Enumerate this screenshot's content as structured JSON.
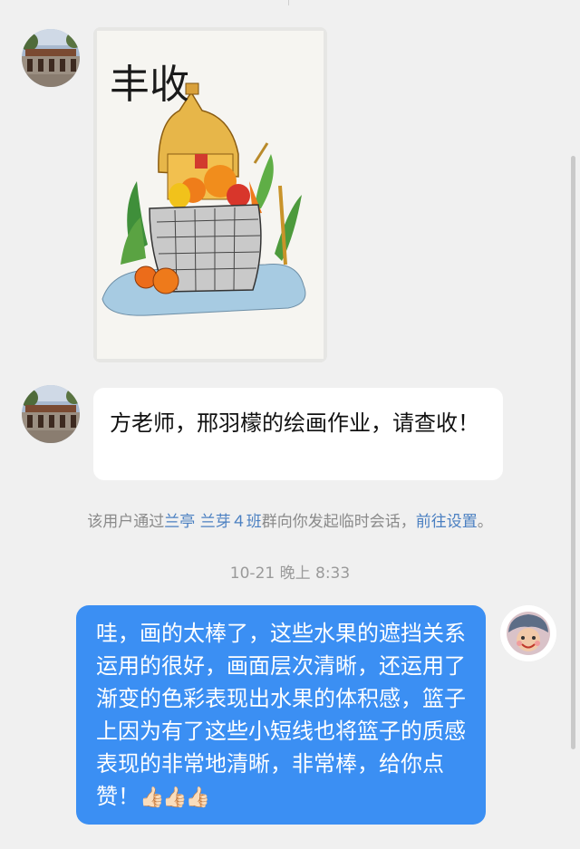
{
  "chat": {
    "messages": [
      {
        "sender": "other",
        "type": "image",
        "image_text": "丰收"
      },
      {
        "sender": "other",
        "type": "text",
        "text": "方老师，邢羽檬的绘画作业，请查收！"
      }
    ],
    "system_notice": {
      "prefix": "该用户通过",
      "group_link": "兰亭 兰芽４班",
      "middle": "群向你发起临时会话，",
      "settings_link": "前往设置",
      "suffix": "。"
    },
    "timestamp": "10-21 晚上 8:33",
    "reply": {
      "sender": "me",
      "text": "哇，画的太棒了，这些水果的遮挡关系运用的很好，画面层次清晰，还运用了渐变的色彩表现出水果的体积感，篮子上因为有了这些小短线也将篮子的质感表现的非常地清晰，非常棒，给你点赞！",
      "emoji": "👍🏻👍🏻👍🏻"
    }
  },
  "colors": {
    "background": "#f0f0f0",
    "incoming_bubble": "#ffffff",
    "outgoing_bubble": "#3b8ff3",
    "link": "#4a7fc1",
    "system_text": "#8a8a8a"
  }
}
